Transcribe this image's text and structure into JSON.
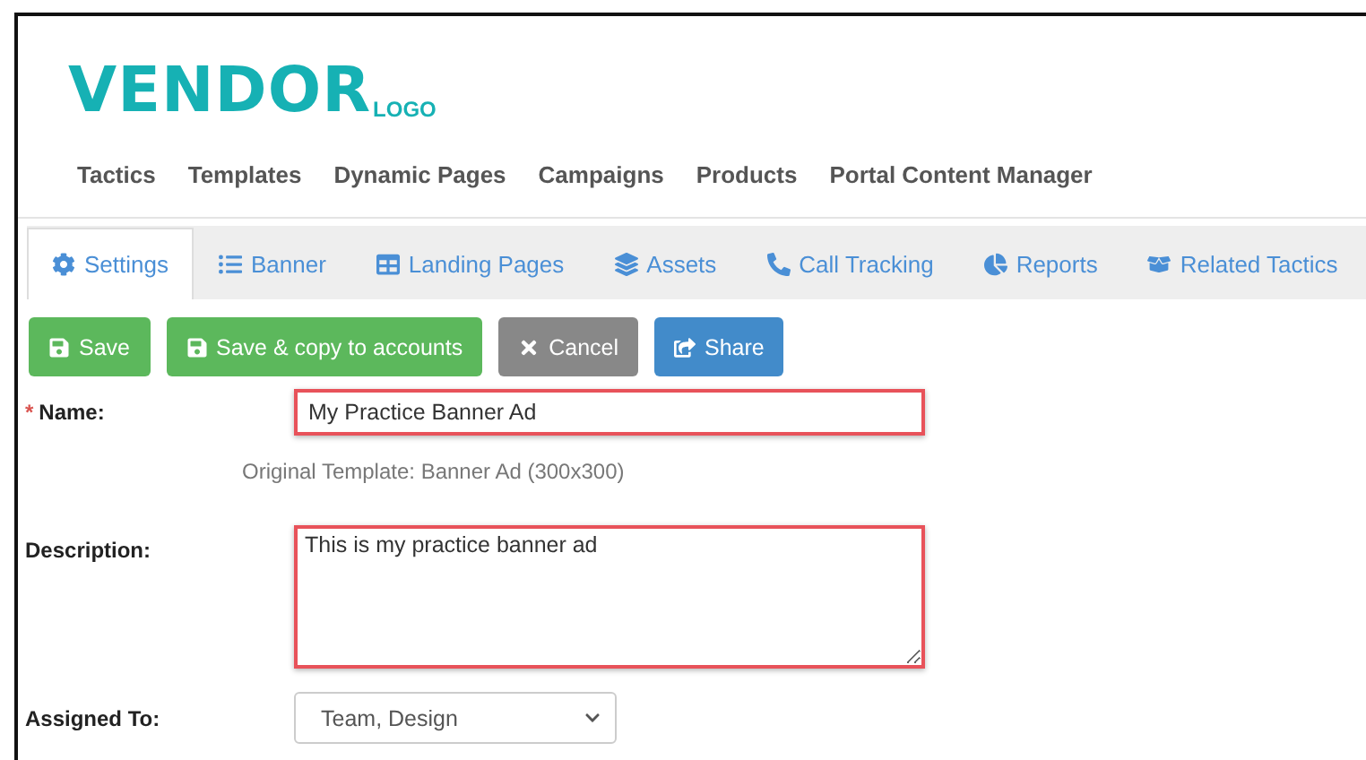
{
  "logo": {
    "wordmark": "VENDOR",
    "suffix": "LOGO"
  },
  "nav": [
    {
      "label": "Tactics"
    },
    {
      "label": "Templates"
    },
    {
      "label": "Dynamic Pages"
    },
    {
      "label": "Campaigns"
    },
    {
      "label": "Products"
    },
    {
      "label": "Portal Content Manager"
    }
  ],
  "tabs": [
    {
      "label": "Settings",
      "selected": true
    },
    {
      "label": "Banner",
      "selected": false
    },
    {
      "label": "Landing Pages",
      "selected": false
    },
    {
      "label": "Assets",
      "selected": false
    },
    {
      "label": "Call Tracking",
      "selected": false
    },
    {
      "label": "Reports",
      "selected": false
    },
    {
      "label": "Related Tactics",
      "selected": false
    }
  ],
  "buttons": [
    {
      "label": "Save",
      "kind": "success"
    },
    {
      "label": "Save & copy to accounts",
      "kind": "success"
    },
    {
      "label": "Cancel",
      "kind": "neutral"
    },
    {
      "label": "Share",
      "kind": "primary"
    }
  ],
  "form": {
    "name": {
      "label": "Name:",
      "required": true,
      "required_mark": "*",
      "value": "My Practice Banner Ad",
      "highlighted": true
    },
    "template_note": "Original Template: Banner Ad (300x300)",
    "description": {
      "label": "Description:",
      "value": "This is my practice banner ad",
      "highlighted": true
    },
    "assigned_to": {
      "label": "Assigned To:",
      "value": "Team, Design"
    }
  }
}
